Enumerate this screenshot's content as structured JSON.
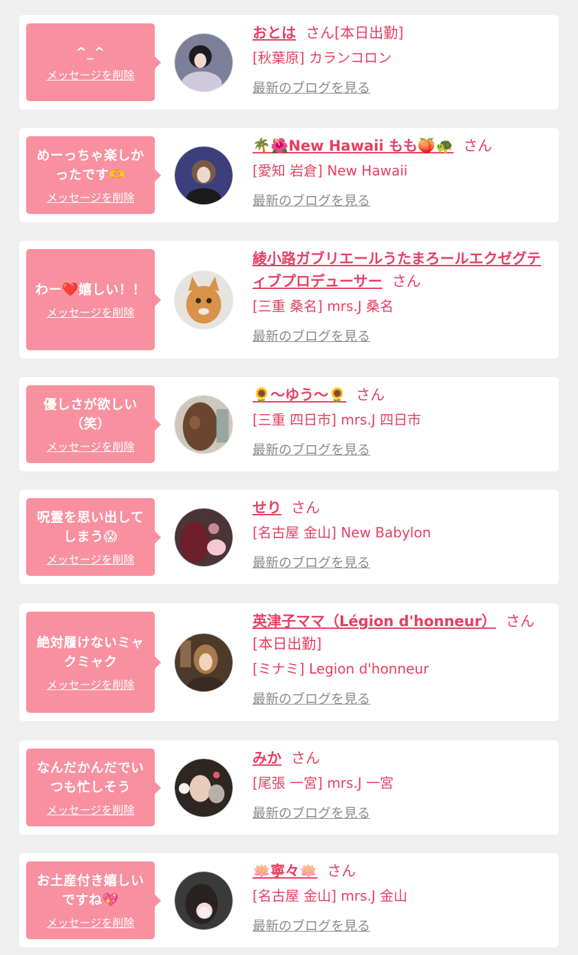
{
  "delete_label": "メッセージを削除",
  "blog_label": "最新のブログを見る",
  "cards": [
    {
      "message": "^_^",
      "name": "おとは",
      "suffix": "さん[本日出勤]",
      "shop": "[秋葉原] カランコロン"
    },
    {
      "message": "めーっちゃ楽しかったです🫶",
      "name": "🌴🌺New Hawaii もも🍑🐢",
      "suffix": "さん",
      "shop": "[愛知 岩倉] New Hawaii"
    },
    {
      "message": "わー❤️嬉しい！！",
      "name": "綾小路ガブリエールうたまろールエクゼグティブプロデューサー",
      "suffix": "さん",
      "shop": "[三重 桑名] mrs.J 桑名"
    },
    {
      "message": "優しさが欲しい（笑）",
      "name": "🌻〜ゆう〜🌻",
      "suffix": "さん",
      "shop": "[三重 四日市] mrs.J 四日市"
    },
    {
      "message": "呪霊を思い出してしまう😱",
      "name": "せり",
      "suffix": "さん",
      "shop": "[名古屋 金山] New Babylon"
    },
    {
      "message": "絶対履けないミャクミャク",
      "name": "英津子ママ（Légion d'honneur）",
      "suffix": "さん[本日出勤]",
      "shop": "[ミナミ] Legion d'honneur"
    },
    {
      "message": "なんだかんだでいつも忙しそう",
      "name": "みか",
      "suffix": "さん",
      "shop": "[尾張 一宮] mrs.J 一宮"
    },
    {
      "message": "お土産付き嬉しいですね💖",
      "name": "🪷寧々🪷",
      "suffix": "さん",
      "shop": "[名古屋 金山] mrs.J 金山"
    }
  ],
  "colors": {
    "bubble": "#f8909f",
    "accent": "#e63e62",
    "link_gray": "#8a8a8a",
    "background": "#efefef"
  }
}
